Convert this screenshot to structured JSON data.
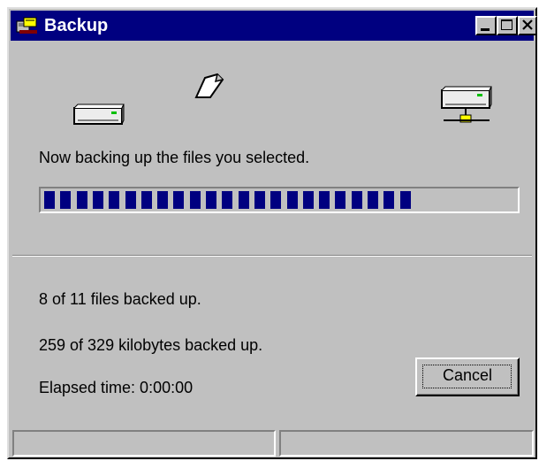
{
  "window": {
    "title": "Backup",
    "icon": "backup-app-icon",
    "controls": [
      "minimize-icon",
      "maximize-icon",
      "close-icon"
    ]
  },
  "animation": {
    "source_icon": "drive-icon",
    "moving_icon": "flying-document-icon",
    "destination_icon": "network-drive-icon"
  },
  "status_message": "Now backing up the files you selected.",
  "progress": {
    "fraction": 0.73,
    "filled_blocks": 23
  },
  "stats": {
    "files": "8 of 11 files backed up.",
    "kilobytes": "259 of 329 kilobytes backed up.",
    "elapsed": "Elapsed time:  0:00:00"
  },
  "buttons": {
    "cancel": "Cancel"
  },
  "statusbar": {
    "pane1": "",
    "pane2": ""
  },
  "colors": {
    "title_bar": "#000080",
    "face": "#c0c0c0",
    "progress_block": "#000080"
  }
}
